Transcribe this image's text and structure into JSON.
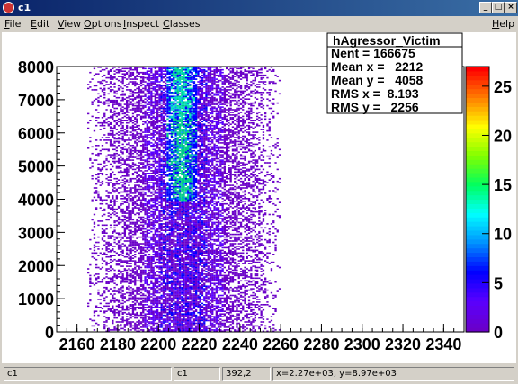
{
  "window": {
    "title": "c1"
  },
  "menu": [
    "File",
    "Edit",
    "View",
    "Options",
    "Inspect",
    "Classes"
  ],
  "help": "Help",
  "stats": {
    "name": "hAgressor_Victim",
    "lines": [
      "Nent = 166675",
      "Mean x =   2212",
      "Mean y =   4058",
      "RMS x =  8.193",
      "RMS y =   2256"
    ]
  },
  "axes": {
    "x_ticks": [
      "2160",
      "2180",
      "2200",
      "2220",
      "2240",
      "2260",
      "2280",
      "2300",
      "2320",
      "2340"
    ],
    "y_ticks": [
      "0",
      "1000",
      "2000",
      "3000",
      "4000",
      "5000",
      "6000",
      "7000",
      "8000"
    ],
    "z_ticks": [
      "0",
      "5",
      "10",
      "15",
      "20",
      "25"
    ]
  },
  "status": {
    "f1": "c1",
    "f2": "c1",
    "f3": "392,2",
    "f4": "x=2.27e+03, y=8.97e+03"
  },
  "chart_data": {
    "type": "heatmap",
    "title": "hAgressor_Victim",
    "xlim": [
      2150,
      2350
    ],
    "ylim": [
      0,
      8000
    ],
    "zlim": [
      0,
      27
    ],
    "x_ticks": [
      2160,
      2180,
      2200,
      2220,
      2240,
      2260,
      2280,
      2300,
      2320,
      2340
    ],
    "y_ticks": [
      0,
      1000,
      2000,
      3000,
      4000,
      5000,
      6000,
      7000,
      8000
    ],
    "z_ticks": [
      0,
      5,
      10,
      15,
      20,
      25
    ],
    "entries": 166675,
    "mean_x": 2212,
    "mean_y": 4058,
    "rms_x": 8.193,
    "rms_y": 2256,
    "colors": {
      "high_band": "#00cc88",
      "palette": [
        "#6a00c8",
        "#5a00ff",
        "#0000ff",
        "#0090ff",
        "#00ffff",
        "#00ff60",
        "#80ff00",
        "#ffff00",
        "#ff8000",
        "#ff0000"
      ]
    }
  }
}
